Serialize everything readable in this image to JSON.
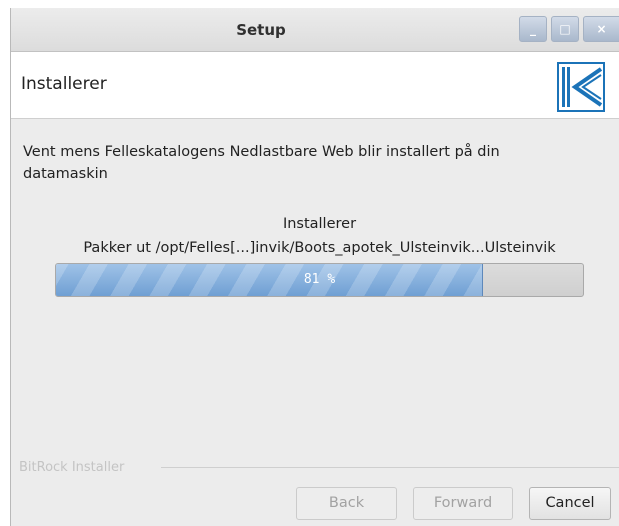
{
  "window": {
    "title": "Setup",
    "controls": {
      "minimize": "_",
      "maximize": "□",
      "close": "×"
    }
  },
  "header": {
    "title": "Installerer",
    "logo_icon": "k-logo-icon",
    "logo_color": "#1b73b8"
  },
  "main": {
    "description": "Vent mens Felleskatalogens Nedlastbare Web blir installert på din datamaskin",
    "progress": {
      "heading": "Installerer",
      "file": "Pakker ut /opt/Felles[...]invik/Boots_apotek_Ulsteinvik...Ulsteinvik",
      "percent_label": "81 %",
      "value": 81
    }
  },
  "footer": {
    "brand": "BitRock Installer",
    "buttons": {
      "back": "Back",
      "forward": "Forward",
      "cancel": "Cancel"
    }
  }
}
